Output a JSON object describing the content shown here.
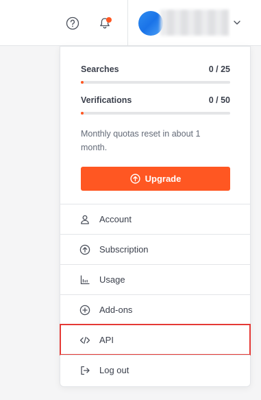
{
  "header": {
    "help_icon": "question-circle-icon",
    "notifications_icon": "bell-icon",
    "notification_dot_color": "#ff5722",
    "user_menu_icon": "chevron-down-icon"
  },
  "quotas": {
    "searches": {
      "label": "Searches",
      "count": "0 / 25",
      "progress": 0
    },
    "verifications": {
      "label": "Verifications",
      "count": "0 / 50",
      "progress": 0
    },
    "reset_note": "Monthly quotas reset in about 1 month."
  },
  "upgrade": {
    "label": "Upgrade",
    "icon": "arrow-up-circle-icon",
    "color": "#ff5722"
  },
  "menu": [
    {
      "label": "Account",
      "icon": "user-icon"
    },
    {
      "label": "Subscription",
      "icon": "arrow-up-circle-icon"
    },
    {
      "label": "Usage",
      "icon": "chart-icon"
    },
    {
      "label": "Add-ons",
      "icon": "plus-circle-icon"
    },
    {
      "label": "API",
      "icon": "code-icon",
      "highlighted": true
    },
    {
      "label": "Log out",
      "icon": "logout-icon"
    }
  ]
}
